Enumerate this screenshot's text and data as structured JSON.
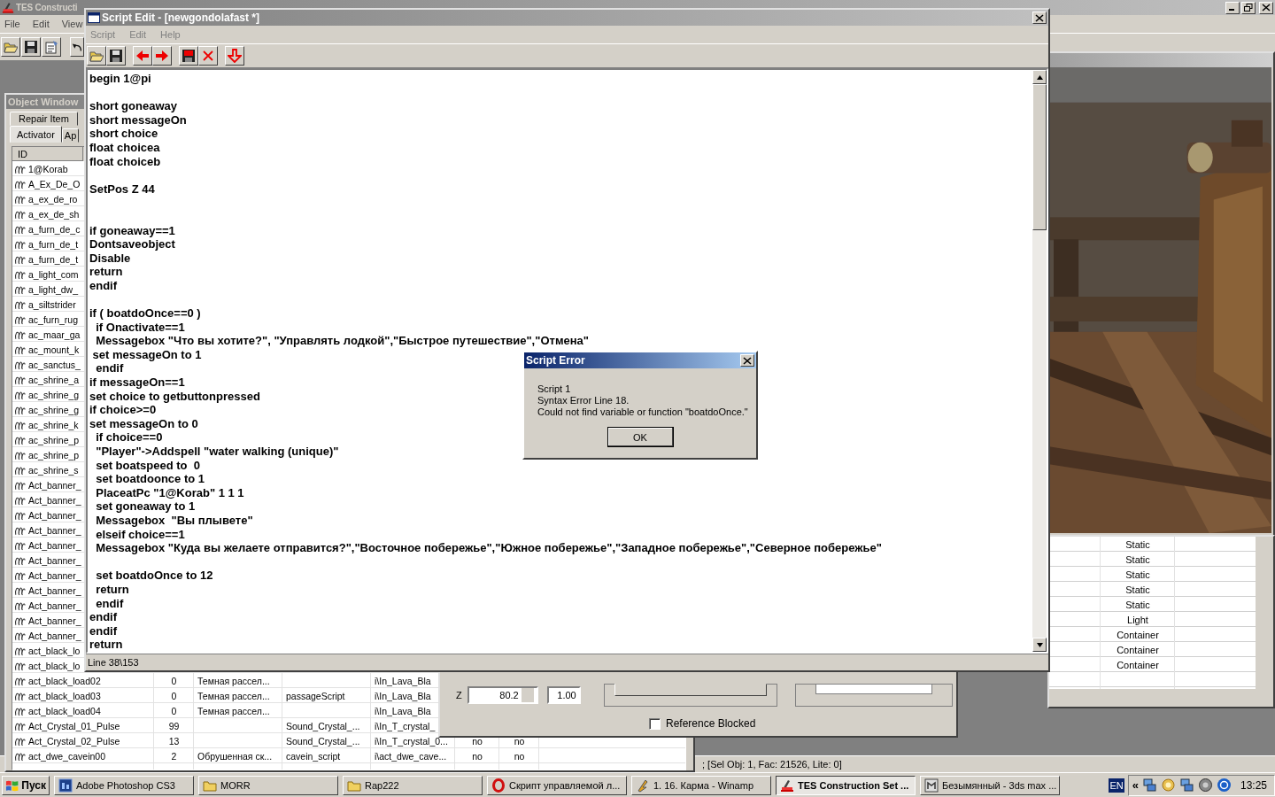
{
  "main_window": {
    "title": "TES Constructi",
    "menu": [
      "File",
      "Edit",
      "View"
    ],
    "status": "; [Sel Obj: 1, Fac: 21526, Lite: 0]"
  },
  "object_window": {
    "title": "Object Window",
    "tabs_back_row": [
      {
        "label": "Repair Item",
        "selected": false
      }
    ],
    "tabs_front_row": [
      {
        "label": "Activator",
        "selected": true
      },
      {
        "label": "Ap",
        "selected": false
      }
    ],
    "column_1": "ID",
    "rows": [
      {
        "column_1": "1@Korab"
      },
      {
        "column_1": "A_Ex_De_O"
      },
      {
        "column_1": "a_ex_de_ro"
      },
      {
        "column_1": "a_ex_de_sh"
      },
      {
        "column_1": "a_furn_de_c"
      },
      {
        "column_1": "a_furn_de_t"
      },
      {
        "column_1": "a_furn_de_t"
      },
      {
        "column_1": "a_light_com"
      },
      {
        "column_1": "a_light_dw_"
      },
      {
        "column_1": "a_siltstrider"
      },
      {
        "column_1": "ac_furn_rug"
      },
      {
        "column_1": "ac_maar_ga"
      },
      {
        "column_1": "ac_mount_k"
      },
      {
        "column_1": "ac_sanctus_"
      },
      {
        "column_1": "ac_shrine_a"
      },
      {
        "column_1": "ac_shrine_g"
      },
      {
        "column_1": "ac_shrine_g"
      },
      {
        "column_1": "ac_shrine_k"
      },
      {
        "column_1": "ac_shrine_p"
      },
      {
        "column_1": "ac_shrine_p"
      },
      {
        "column_1": "ac_shrine_s"
      },
      {
        "column_1": "Act_banner_"
      },
      {
        "column_1": "Act_banner_"
      },
      {
        "column_1": "Act_banner_"
      },
      {
        "column_1": "Act_banner_"
      },
      {
        "column_1": "Act_banner_"
      },
      {
        "column_1": "Act_banner_"
      },
      {
        "column_1": "Act_banner_"
      },
      {
        "column_1": "Act_banner_"
      },
      {
        "column_1": "Act_banner_"
      },
      {
        "column_1": "Act_banner_"
      },
      {
        "column_1": "Act_banner_"
      },
      {
        "column_1": "act_black_lo"
      },
      {
        "column_1": "act_black_lo"
      },
      {
        "column_1": "act_black_load02",
        "column_2": "0",
        "column_3": "Темная рассел...",
        "column_5": "i\\In_Lava_Bla"
      },
      {
        "column_1": "act_black_load03",
        "column_2": "0",
        "column_3": "Темная рассел...",
        "column_4": "passageScript",
        "column_5": "i\\In_Lava_Bla"
      },
      {
        "column_1": "act_black_load04",
        "column_2": "0",
        "column_3": "Темная рассел...",
        "column_5": "i\\In_Lava_Bla"
      },
      {
        "column_1": "Act_Crystal_01_Pulse",
        "column_2": "99",
        "column_4": "Sound_Crystal_...",
        "column_5": "i\\In_T_crystal_"
      },
      {
        "column_1": "Act_Crystal_02_Pulse",
        "column_2": "13",
        "column_4": "Sound_Crystal_...",
        "column_5": "i\\In_T_crystal_0...",
        "column_6": "no",
        "column_7": "no"
      },
      {
        "column_1": "act_dwe_cavein00",
        "column_2": "2",
        "column_3": "Обрушенная ск...",
        "column_4": "cavein_script",
        "column_5": "i\\act_dwe_cave...",
        "column_6": "no",
        "column_7": "no"
      }
    ]
  },
  "reference_dialog": {
    "z_label": "Z",
    "z_value": "80.2",
    "scale_value": "1.00",
    "reference_blocked": {
      "label": "Reference Blocked",
      "checked": false
    }
  },
  "cell_view": {
    "rows": [
      "Static",
      "Static",
      "Static",
      "Static",
      "Static",
      "Light",
      "Container",
      "Container",
      "Container"
    ]
  },
  "script_edit": {
    "title": "Script Edit - [newgondolafast *]",
    "menu": [
      "Script",
      "Edit",
      "Help"
    ],
    "code": "begin 1@pi\n\nshort goneaway\nshort messageOn\nshort choice\nfloat choicea\nfloat choiceb\n\nSetPos Z 44\n\n\nif goneaway==1\nDontsaveobject\nDisable\nreturn\nendif\n\nif ( boatdoOnce==0 )\n  if Onactivate==1\n  Messagebox \"Что вы хотите?\", \"Управлять лодкой\",\"Быстрое путешествие\",\"Отмена\"\n set messageOn to 1\n  endif\nif messageOn==1\nset choice to getbuttonpressed\nif choice>=0\nset messageOn to 0\n  if choice==0\n  \"Player\"->Addspell \"water walking (unique)\"\n  set boatspeed to  0\n  set boatdoonce to 1\n  PlaceatPc \"1@Korab\" 1 1 1\n  set goneaway to 1\n  Messagebox  \"Вы плывете\"\n  elseif choice==1\n  Messagebox \"Куда вы желаете отправится?\",\"Восточное побережье\",\"Южное побережье\",\"Западное побережье\",\"Северное побережье\"\n\n  set boatdoOnce to 12\n  return\n  endif\nendif\nendif\nreturn",
    "status": "Line 38\\153"
  },
  "error_dialog": {
    "title": "Script Error",
    "lines": [
      "Script 1",
      "Syntax Error Line 18.",
      "Could not find variable or function \"boatdoOnce.\""
    ],
    "button": "OK"
  },
  "taskbar": {
    "start": "Пуск",
    "items": [
      {
        "label": "Adobe Photoshop CS3",
        "kind": "ps",
        "selected": false
      },
      {
        "label": "MORR",
        "kind": "folder",
        "selected": false
      },
      {
        "label": "Rap222",
        "kind": "folder",
        "selected": false
      },
      {
        "label": "Скрипт управляемой л...",
        "kind": "browser",
        "selected": false
      },
      {
        "label": "1. 16. Карма - Winamp",
        "kind": "player",
        "selected": false
      },
      {
        "label": "TES Construction Set ...",
        "kind": "tes",
        "selected": true
      },
      {
        "label": "Безымянный - 3ds max ...",
        "kind": "max",
        "selected": false
      }
    ],
    "language": "EN",
    "tray_toggle": "«",
    "clock": "13:25"
  }
}
